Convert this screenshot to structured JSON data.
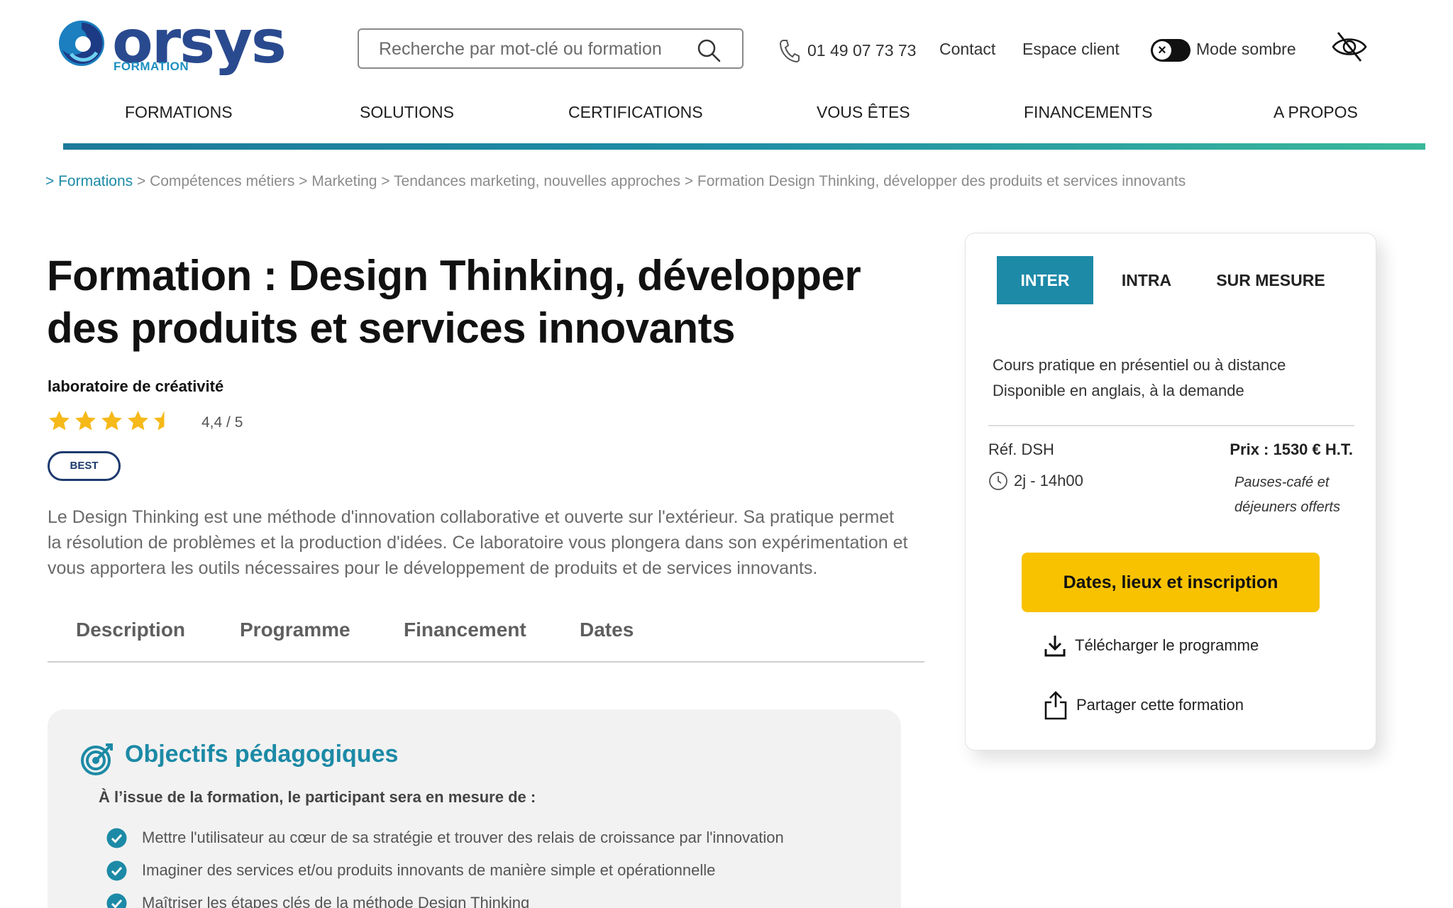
{
  "header": {
    "logo_text": "orsys",
    "logo_sub": "FORMATION",
    "search_placeholder": "Recherche par mot-clé ou formation",
    "phone": "01 49 07 73 73",
    "contact": "Contact",
    "client_space": "Espace client",
    "dark_mode_label": "Mode sombre",
    "dark_mode_knob": "×"
  },
  "nav": {
    "items": [
      "FORMATIONS",
      "SOLUTIONS",
      "CERTIFICATIONS",
      "VOUS ÊTES",
      "FINANCEMENTS",
      "A PROPOS"
    ]
  },
  "breadcrumb": {
    "first": "> Formations",
    "rest": [
      "Compétences métiers",
      "Marketing",
      "Tendances marketing, nouvelles approches",
      "Formation Design Thinking, développer des produits et services innovants"
    ],
    "separator": " > "
  },
  "main": {
    "title_line1": "Formation : Design Thinking, développer",
    "title_line2": "des produits et services innovants",
    "subtitle": "laboratoire de créativité",
    "rating_value": 4.4,
    "rating_max": 5,
    "rating_text": "4,4 / 5",
    "badge": "BEST",
    "intro": "Le Design Thinking est une méthode d'innovation collaborative et ouverte sur l'extérieur. Sa pratique permet la résolution de problèmes et la production d'idées. Ce laboratoire vous plongera dans son expérimentation et vous apportera les outils nécessaires pour le développement de produits et de services innovants.",
    "tabs": [
      "Description",
      "Programme",
      "Financement",
      "Dates"
    ]
  },
  "objectives": {
    "title": "Objectifs pédagogiques",
    "lead": "À l’issue de la formation, le participant sera en mesure de :",
    "items": [
      "Mettre l'utilisateur au cœur de sa stratégie et trouver des relais de croissance par l'innovation",
      "Imaginer des services et/ou produits innovants de manière simple et opérationnelle",
      "Maîtriser les étapes clés de la méthode Design Thinking"
    ]
  },
  "card": {
    "tabs": [
      "INTER",
      "INTRA",
      "SUR MESURE"
    ],
    "active_tab": "INTER",
    "desc_line1": "Cours pratique en présentiel ou à distance",
    "desc_line2": "Disponible en anglais, à la demande",
    "ref": "Réf. DSH",
    "duration": "2j - 14h00",
    "price": "Prix : 1530 € H.T.",
    "price_note_line1": "Pauses-café et",
    "price_note_line2": "déjeuners offerts",
    "cta": "Dates, lieux et inscription",
    "download": "Télécharger le programme",
    "share": "Partager cette formation"
  },
  "colors": {
    "brand_blue": "#2a4a8f",
    "teal": "#1d8aa8",
    "cta_yellow": "#f8c200",
    "star_yellow": "#f6b91a"
  }
}
